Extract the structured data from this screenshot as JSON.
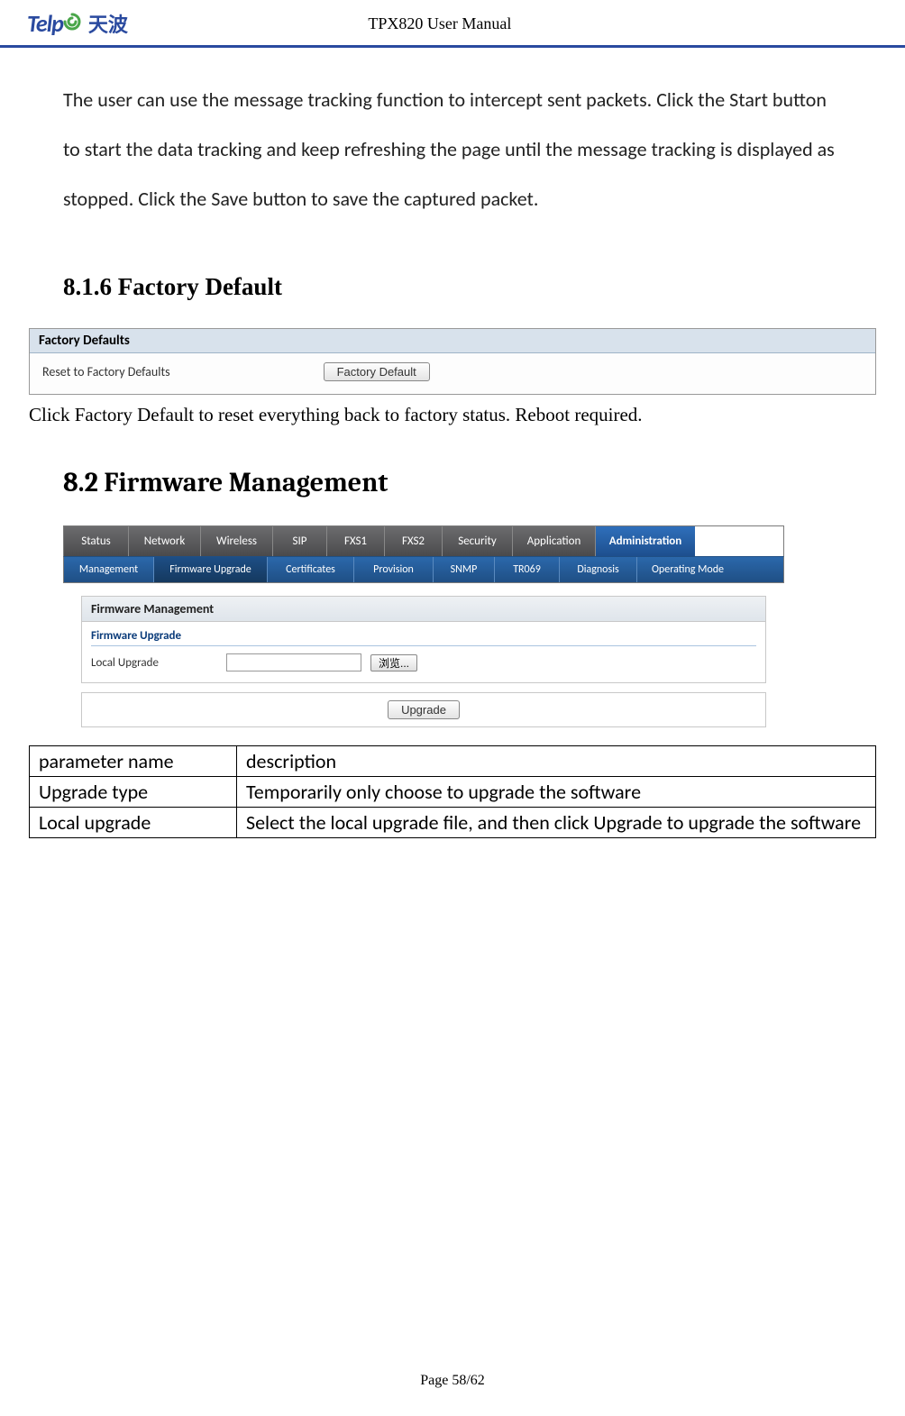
{
  "header": {
    "logo_en": "Telp",
    "logo_cn": "天波",
    "title": "TPX820 User Manual"
  },
  "intro": "The user can use the message tracking function to intercept sent packets. Click the Start button to start the data tracking and keep refreshing the page until the message tracking is displayed as stopped. Click the Save button to save the captured packet.",
  "section_factory": {
    "heading": "8.1.6 Factory Default",
    "box_title": "Factory Defaults",
    "label": "Reset to Factory Defaults",
    "button": "Factory Default",
    "caption": "Click Factory Default to reset everything back to factory status. Reboot required."
  },
  "section_firmware": {
    "heading": "8.2 Firmware Management",
    "tabs": {
      "main": [
        "Status",
        "Network",
        "Wireless",
        "SIP",
        "FXS1",
        "FXS2",
        "Security",
        "Application",
        "Administration"
      ],
      "main_widths": [
        72,
        80,
        80,
        60,
        64,
        64,
        78,
        92,
        110
      ],
      "sub": [
        "Management",
        "Firmware Upgrade",
        "Certificates",
        "Provision",
        "SNMP",
        "TR069",
        "Diagnosis",
        "Operating Mode"
      ],
      "sub_widths": [
        100,
        126,
        96,
        88,
        68,
        72,
        86,
        112
      ],
      "panel_title": "Firmware Management",
      "subheader": "Firmware Upgrade",
      "row_label": "Local Upgrade",
      "browse_button": "浏览...",
      "upgrade_button": "Upgrade"
    },
    "table": {
      "headers": [
        "parameter name",
        "description"
      ],
      "rows": [
        [
          "Upgrade type",
          "Temporarily only choose to upgrade the software"
        ],
        [
          "Local upgrade",
          "Select the local upgrade file, and then click Upgrade to upgrade the software"
        ]
      ]
    }
  },
  "footer": "Page 58/62"
}
